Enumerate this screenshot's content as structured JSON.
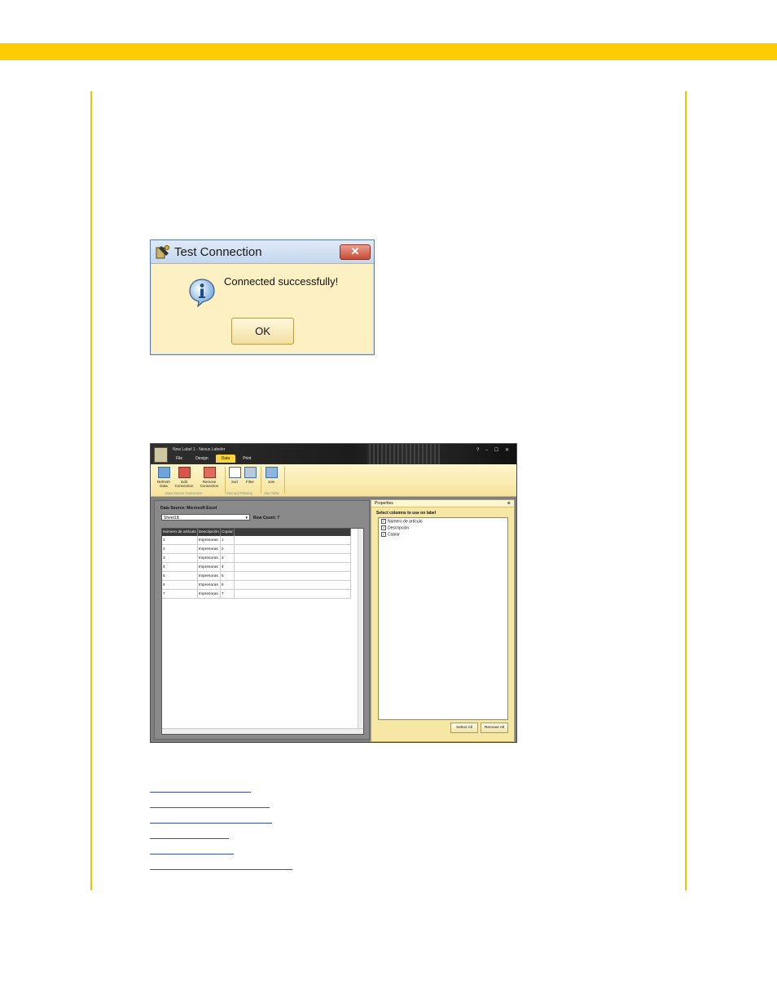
{
  "dialog": {
    "title": "Test Connection",
    "message": "Connected successfully!",
    "ok_label": "OK",
    "close_glyph": "✕",
    "icons": [
      "app-icon",
      "info-icon",
      "close-icon"
    ]
  },
  "app": {
    "title": "New Label 1 - Nexus Labeler",
    "window_controls": "? – ☐ ✕",
    "menu": [
      "File",
      "Design",
      "Data",
      "Print"
    ],
    "active_menu": "Data",
    "ribbon": {
      "buttons": [
        {
          "label": "Refresh Data"
        },
        {
          "label": "Edit Connection"
        },
        {
          "label": "Remove Connection"
        },
        {
          "label": "Sort"
        },
        {
          "label": "Filter"
        },
        {
          "label": "Join"
        }
      ],
      "groups": [
        "Data Source Connection",
        "Sort and Filtering",
        "Join Table"
      ]
    },
    "data_source_label": "Data Source: Microsoft Excel",
    "sheet_value": "Sheet1$",
    "row_count_label": "Row Count: 7",
    "table": {
      "headers": [
        "Número de artículo",
        "Descripción",
        "Copiar"
      ],
      "rows": [
        [
          "1",
          "Impresoras",
          "1"
        ],
        [
          "2",
          "Impresoras",
          "2"
        ],
        [
          "3",
          "Impresoras",
          "3"
        ],
        [
          "4",
          "Impresoras",
          "4"
        ],
        [
          "5",
          "Impresoras",
          "5"
        ],
        [
          "6",
          "Impresoras",
          "6"
        ],
        [
          "7",
          "Impresoras",
          "7"
        ]
      ]
    },
    "properties": {
      "header": "Properties",
      "pin": "⊕",
      "subtitle": "Select columns to use on label",
      "columns": [
        "Número de artículo",
        "Descripción",
        "Copiar"
      ],
      "select_all": "Select All",
      "remove_all": "Remove All"
    }
  },
  "colors": {
    "accent_bar": "#ffcc00",
    "page_rule": "#f2c200",
    "link": "#3550b5",
    "dialog_bg": "#fdf1c3"
  }
}
